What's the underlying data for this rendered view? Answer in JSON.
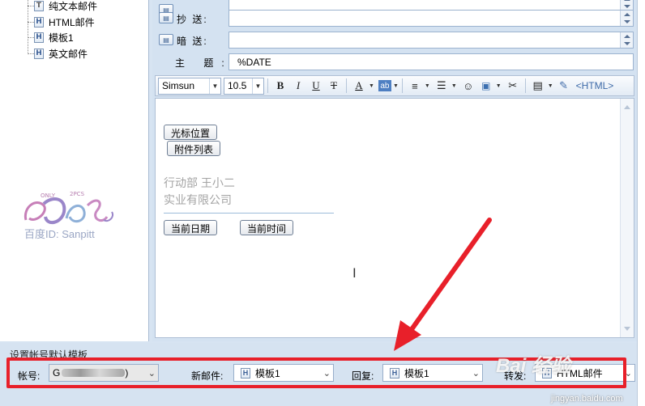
{
  "tree": {
    "items": [
      {
        "label": "纯文本邮件",
        "icon": "T"
      },
      {
        "label": "HTML邮件",
        "icon": "H"
      },
      {
        "label": "模板1",
        "icon": "H"
      },
      {
        "label": "英文邮件",
        "icon": "H"
      }
    ],
    "watermark": "百度ID: Sanpitt"
  },
  "headers": {
    "cc_label": "抄 送:",
    "bcc_label": "暗 送:",
    "subject_label": "主 题:",
    "subject_value": "%DATE"
  },
  "toolbar": {
    "font": "Simsun",
    "size": "10.5",
    "bold": "B",
    "italic": "I",
    "underline": "U",
    "strike": "T",
    "font_color": "A",
    "highlight": "ab",
    "html": "<HTML>"
  },
  "editor": {
    "cursor_button": "光标位置",
    "attachments_button": "附件列表",
    "sig_line1": "行动部    王小二",
    "sig_line2": "实业有限公司",
    "date_button": "当前日期",
    "time_button": "当前时间"
  },
  "bottom": {
    "title": "设置帐号默认模板",
    "account_label": "帐号:",
    "account_value_prefix": "G",
    "account_value_suffix": ")",
    "new_mail_label": "新邮件:",
    "new_mail_value": "模板1",
    "reply_label": "回复:",
    "reply_value": "模板1",
    "forward_label": "转发:",
    "forward_value": "HTML邮件"
  },
  "watermark_brand": {
    "text": "Bai 经验",
    "sub": "jingyan.baidu.com"
  },
  "colors": {
    "highlight_red": "#e8202a",
    "panel_blue": "#d4e2f1"
  }
}
